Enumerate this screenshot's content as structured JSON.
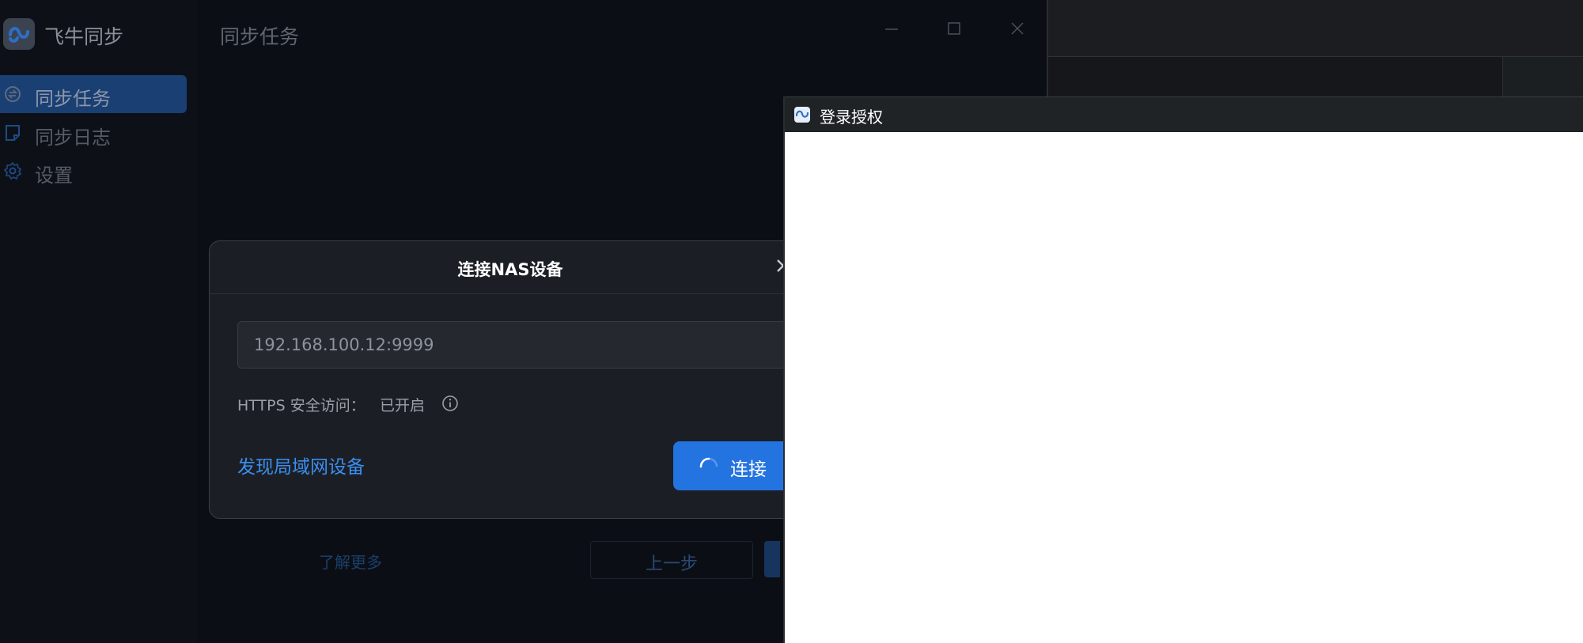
{
  "app": {
    "title": "飞牛同步",
    "page_title": "同步任务",
    "nav": [
      {
        "label": "同步任务",
        "icon": "sync-icon",
        "active": true
      },
      {
        "label": "同步日志",
        "icon": "log-icon",
        "active": false
      },
      {
        "label": "设置",
        "icon": "gear-icon",
        "active": false
      }
    ],
    "bottom": {
      "learn_more": "了解更多",
      "prev": "上一步"
    }
  },
  "dialog": {
    "title": "连接NAS设备",
    "address": "192.168.100.12:9999",
    "https_label": "HTTPS 安全访问：",
    "https_value": "已开启",
    "discover": "发现局域网设备",
    "connect": "连接"
  },
  "login_window": {
    "title": "登录授权"
  },
  "colors": {
    "accent": "#2373e0",
    "link": "#3b8ef0",
    "nav_active": "#1a3f73"
  }
}
